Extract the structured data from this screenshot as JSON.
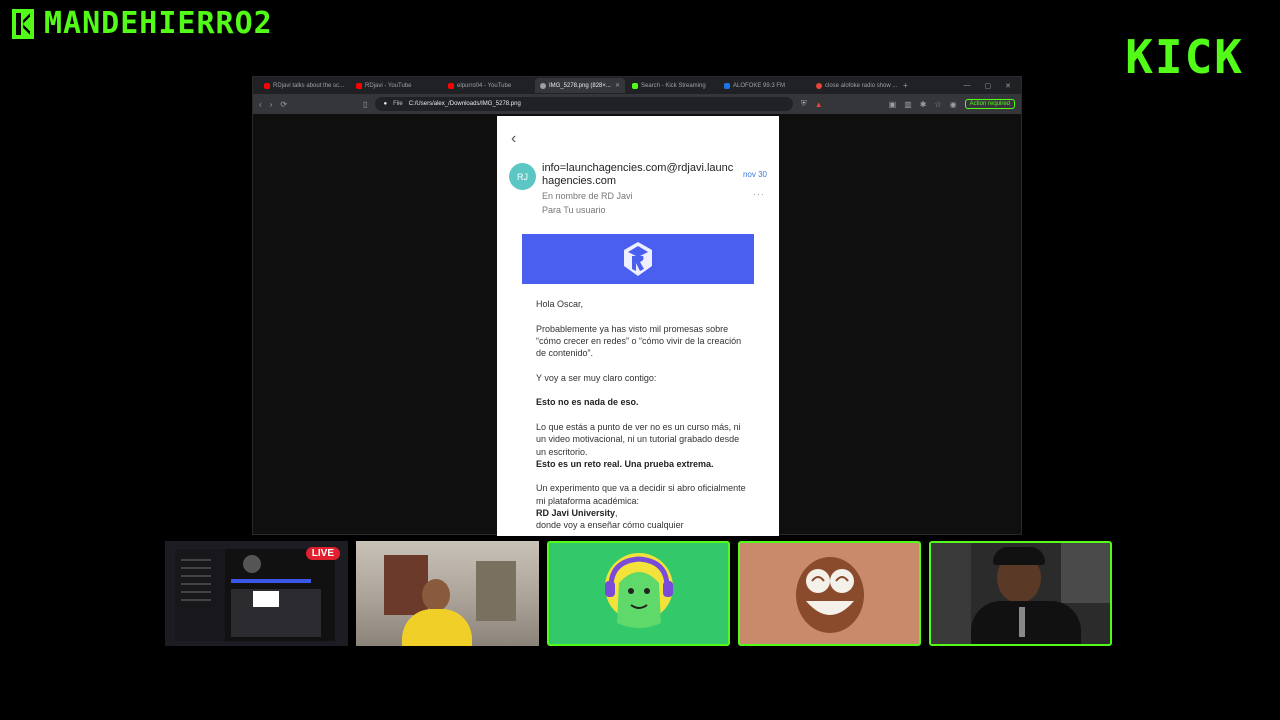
{
  "stream": {
    "channel_name": "MANDEHIERRO2",
    "platform_logo": "KICK",
    "live_badge": "LIVE",
    "accent": "#53fc18"
  },
  "browser": {
    "tabs": [
      {
        "label": "RDjavi talks about the sc...",
        "favicon_color": "#ff0000"
      },
      {
        "label": "RDjavi - YouTube",
        "favicon_color": "#ff0000"
      },
      {
        "label": "elpurro04 - YouTube",
        "favicon_color": "#ff0000"
      },
      {
        "label": "IMG_5278.png (828×...",
        "favicon_color": "#9aa0a6",
        "active": true
      },
      {
        "label": "Search - Kick Streaming",
        "favicon_color": "#53fc18"
      },
      {
        "label": "ALOFOKE 99.3 FM",
        "favicon_color": "#1a73e8"
      },
      {
        "label": "close alofoke radio show ...",
        "favicon_color": "#e8453c"
      }
    ],
    "address": {
      "scheme": "File",
      "url": "C:/Users/alex_/Downloads/IMG_5278.png"
    },
    "action_button": "Action required"
  },
  "email": {
    "avatar_initials": "RJ",
    "sender": "info=launchagencies.com@rdjavi.launchagencies.com",
    "date": "nov 30",
    "on_behalf": "En nombre de RD Javi",
    "to": "Para Tu usuario",
    "greeting": "Hola Oscar,",
    "p1": "Probablemente ya has visto mil promesas sobre “cómo crecer en redes” o “cómo vivir de la creación de contenido”.",
    "p2": "Y voy a ser muy claro contigo:",
    "p3_bold": "Esto no es nada de eso.",
    "p4": "Lo que estás a punto de ver no es un curso más, ni un video motivacional, ni un tutorial grabado desde un escritorio.",
    "p4_bold": "Esto es un reto real. Una prueba extrema.",
    "p5": "Un experimento que va a decidir si abro oficialmente mi plataforma académica:",
    "p5_bold": "RD Javi University",
    "p5_bold_suffix": ",",
    "p6": "donde voy a enseñar cómo cualquier"
  }
}
